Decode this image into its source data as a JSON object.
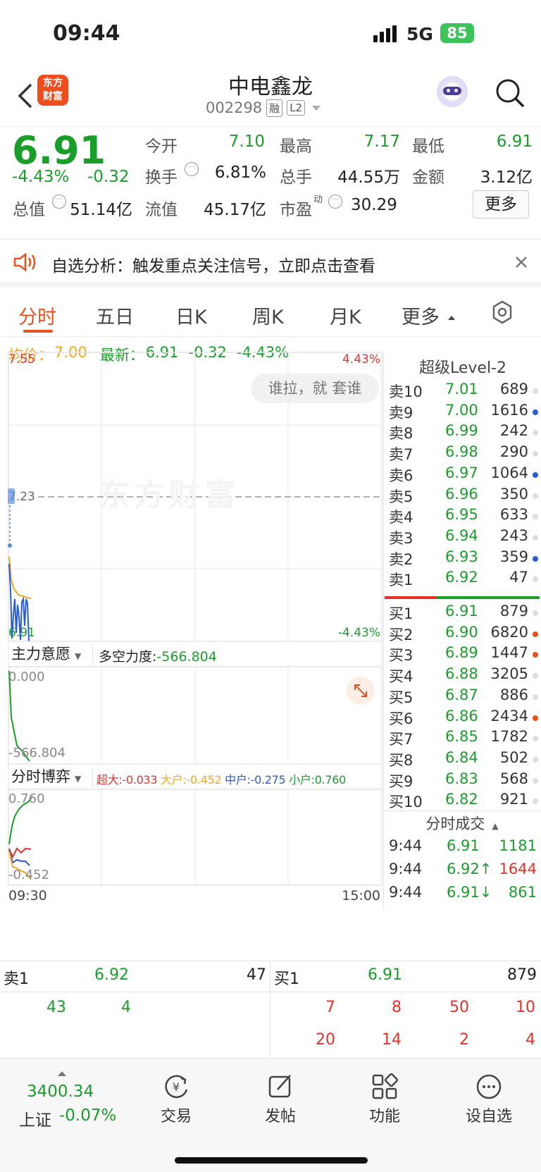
{
  "status": {
    "time": "09:44",
    "network": "5G",
    "battery": "85"
  },
  "header": {
    "name": "中电鑫龙",
    "code": "002298",
    "tag_rong": "融",
    "tag_l2": "L2",
    "logo_l1": "东方",
    "logo_l2": "财富"
  },
  "quote": {
    "price": "6.91",
    "pct": "-4.43%",
    "chg": "-0.32",
    "open_l": "今开",
    "open_v": "7.10",
    "high_l": "最高",
    "high_v": "7.17",
    "low_l": "最低",
    "low_v": "6.91",
    "turn_l": "换手",
    "turn_v": "6.81%",
    "vol_l": "总手",
    "vol_v": "44.55万",
    "amt_l": "金额",
    "amt_v": "3.12亿",
    "mcap_l": "总值",
    "mcap_v": "51.14亿",
    "float_l": "流值",
    "float_v": "45.17亿",
    "pe_l": "市盈",
    "pe_sup": "动",
    "pe_v": "30.29",
    "more": "更多"
  },
  "notice": {
    "text": "自选分析：触发重点关注信号，立即点击查看"
  },
  "tabs": {
    "t1": "分时",
    "t2": "五日",
    "t3": "日K",
    "t4": "周K",
    "t5": "月K",
    "t6": "更多"
  },
  "infoline": {
    "avg_l": "均价：",
    "avg_v": "7.00",
    "new_l": "最新：",
    "new_v": "6.91",
    "chg": "-0.32",
    "pct": "-4.43%"
  },
  "chart": {
    "top": "7.55",
    "top_pct": "4.43%",
    "mid": "7.23",
    "bot": "6.91",
    "bot_pct": "-4.43%",
    "watermark": "东方财富",
    "bubble": "谁拉，就 套谁",
    "t_start": "09:30",
    "t_end": "15:00"
  },
  "ind1": {
    "name": "主力意愿",
    "label": "多空力度:",
    "value": "-566.804",
    "top": "0.000",
    "bot": "-566.804"
  },
  "ind2": {
    "name": "分时博弈",
    "big_l": "超大:",
    "big_v": "-0.033",
    "large_l": "大户:",
    "large_v": "-0.452",
    "mid_l": "中户:",
    "mid_v": "-0.275",
    "small_l": "小户:",
    "small_v": "0.760",
    "top": "0.760",
    "bot": "-0.452"
  },
  "orderbook": {
    "title": "超级Level-2",
    "sells": [
      {
        "l": "卖10",
        "p": "7.01",
        "v": "689"
      },
      {
        "l": "卖9",
        "p": "7.00",
        "v": "1616"
      },
      {
        "l": "卖8",
        "p": "6.99",
        "v": "242"
      },
      {
        "l": "卖7",
        "p": "6.98",
        "v": "290"
      },
      {
        "l": "卖6",
        "p": "6.97",
        "v": "1064"
      },
      {
        "l": "卖5",
        "p": "6.96",
        "v": "350"
      },
      {
        "l": "卖4",
        "p": "6.95",
        "v": "633"
      },
      {
        "l": "卖3",
        "p": "6.94",
        "v": "243"
      },
      {
        "l": "卖2",
        "p": "6.93",
        "v": "359"
      },
      {
        "l": "卖1",
        "p": "6.92",
        "v": "47"
      }
    ],
    "buys": [
      {
        "l": "买1",
        "p": "6.91",
        "v": "879"
      },
      {
        "l": "买2",
        "p": "6.90",
        "v": "6820"
      },
      {
        "l": "买3",
        "p": "6.89",
        "v": "1447"
      },
      {
        "l": "买4",
        "p": "6.88",
        "v": "3205"
      },
      {
        "l": "买5",
        "p": "6.87",
        "v": "886"
      },
      {
        "l": "买6",
        "p": "6.86",
        "v": "2434"
      },
      {
        "l": "买7",
        "p": "6.85",
        "v": "1782"
      },
      {
        "l": "买8",
        "p": "6.84",
        "v": "502"
      },
      {
        "l": "买9",
        "p": "6.83",
        "v": "568"
      },
      {
        "l": "买10",
        "p": "6.82",
        "v": "921"
      }
    ],
    "ticks_title": "分时成交",
    "ticks": [
      {
        "t": "9:44",
        "p": "6.91",
        "v": "1181"
      },
      {
        "t": "9:44",
        "p": "6.92↑",
        "v": "1644"
      },
      {
        "t": "9:44",
        "p": "6.91↓",
        "v": "861"
      }
    ]
  },
  "trade": {
    "sell_l": "卖1",
    "sell_p": "6.92",
    "sell_v": "47",
    "buy_l": "买1",
    "buy_p": "6.91",
    "buy_v": "879",
    "s1": "43",
    "s2": "4",
    "b1": "7",
    "b2": "8",
    "b3": "50",
    "b4": "10",
    "b5": "20",
    "b6": "14",
    "b7": "2",
    "b8": "4"
  },
  "bottom": {
    "index_v": "3400.34",
    "index_n": "上证",
    "index_p": "-0.07%",
    "trade": "交易",
    "post": "发帖",
    "func": "功能",
    "watch": "设自选"
  }
}
